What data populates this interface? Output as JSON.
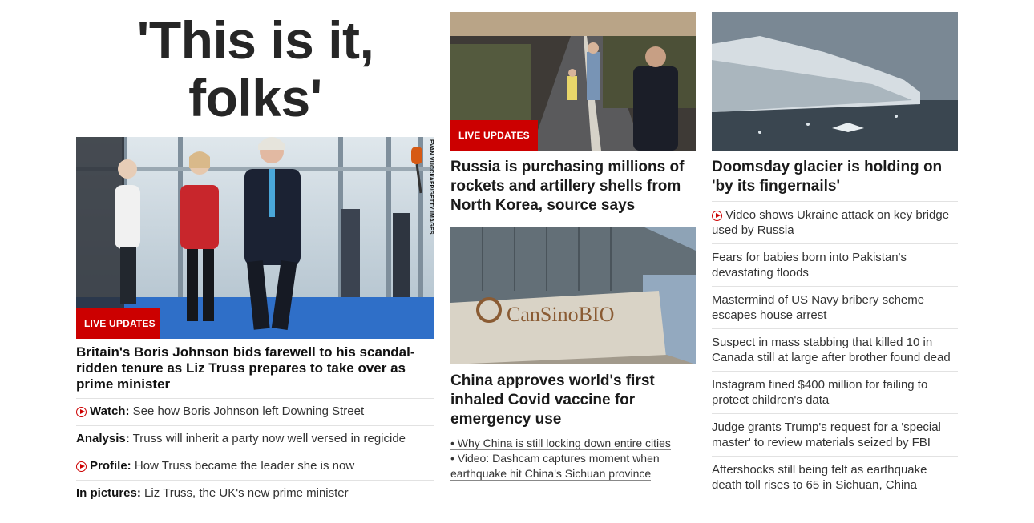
{
  "col1": {
    "big_headline": "'This is it, folks'",
    "hero_image_credit": "EVAN VUCCI/AFP/GETTY IMAGES",
    "live_badge": "LIVE UPDATES",
    "hero_title": "Britain's Boris Johnson bids farewell to his scandal-ridden tenure as Liz Truss prepares to take over as prime minister",
    "related": [
      {
        "prefix": "Watch:",
        "text": "See how Boris Johnson left Downing Street",
        "video": true
      },
      {
        "prefix": "Analysis:",
        "text": "Truss will inherit a party now well versed in regicide",
        "video": false
      },
      {
        "prefix": "Profile:",
        "text": "How Truss became the leader she is now",
        "video": true
      },
      {
        "prefix": "In pictures:",
        "text": "Liz Truss, the UK's new prime minister",
        "video": false
      }
    ]
  },
  "col2": {
    "live_badge": "LIVE UPDATES",
    "story1_title": "Russia is purchasing millions of rockets and artillery shells from North Korea, source says",
    "story2_image_sign": "CanSinoBIO",
    "story2_title": "China approves world's first inhaled Covid vaccine for emergency use",
    "bullets": [
      "• Why China is still locking down entire cities",
      "• Video: Dashcam captures moment when earthquake hit China's Sichuan province"
    ]
  },
  "col3": {
    "title": "Doomsday glacier is holding on 'by its fingernails'",
    "stories": [
      {
        "text": "Video shows Ukraine attack on key bridge used by Russia",
        "video": true
      },
      {
        "text": "Fears for babies born into Pakistan's devastating floods",
        "video": false
      },
      {
        "text": "Mastermind of US Navy bribery scheme escapes house arrest",
        "video": false
      },
      {
        "text": "Suspect in mass stabbing that killed 10 in Canada still at large after brother found dead",
        "video": false
      },
      {
        "text": "Instagram fined $400 million for failing to protect children's data",
        "video": false
      },
      {
        "text": "Judge grants Trump's request for a 'special master' to review materials seized by FBI",
        "video": false
      },
      {
        "text": "Aftershocks still being felt as earthquake death toll rises to 65 in Sichuan, China",
        "video": false
      }
    ]
  },
  "colors": {
    "accent_red": "#cc0000",
    "divider": "#e2e2e2",
    "text": "#333333"
  }
}
